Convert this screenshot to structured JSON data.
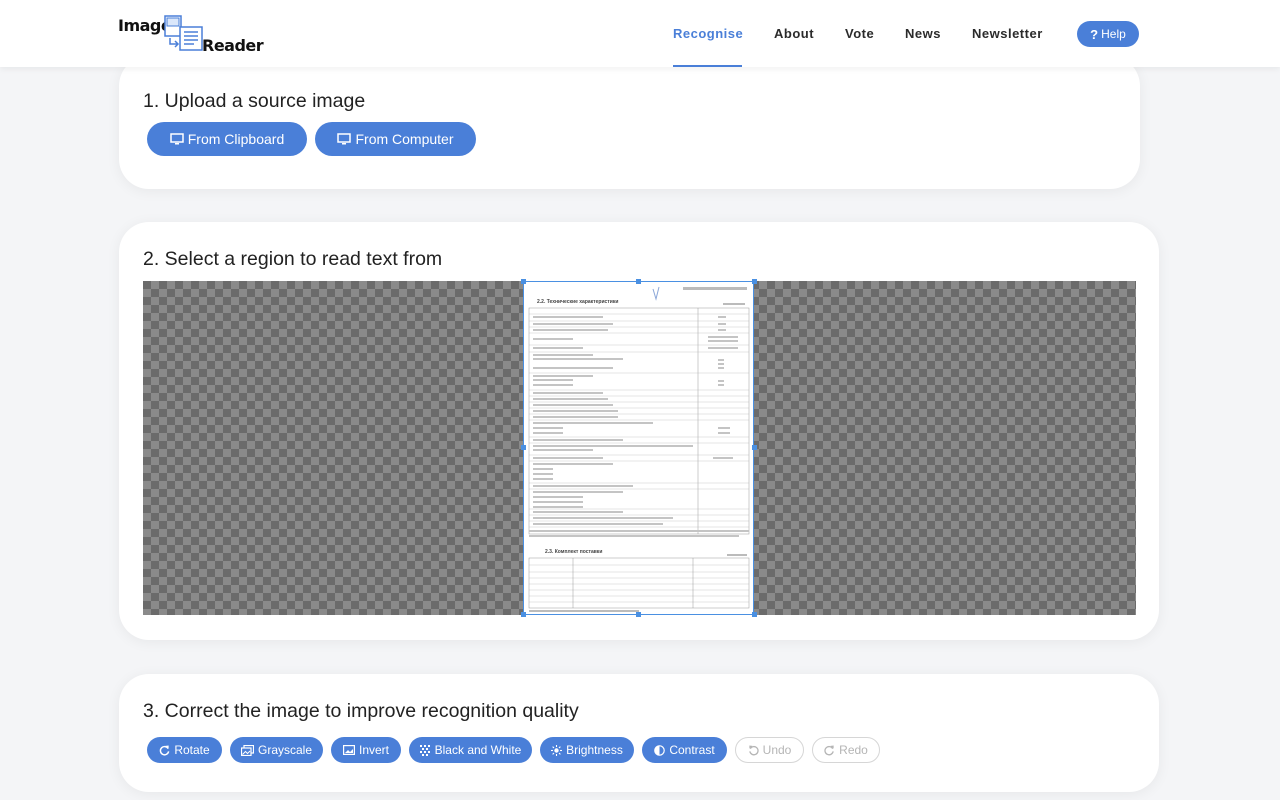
{
  "header": {
    "logo": {
      "word1": "Image",
      "word2": "Reader"
    },
    "nav": [
      {
        "label": "Recognise",
        "active": true
      },
      {
        "label": "About",
        "active": false
      },
      {
        "label": "Vote",
        "active": false
      },
      {
        "label": "News",
        "active": false
      },
      {
        "label": "Newsletter",
        "active": false
      }
    ],
    "help": {
      "label": "Help",
      "icon": "question-icon"
    }
  },
  "step1": {
    "title": "1. Upload a source image",
    "buttons": [
      {
        "label": "From Clipboard",
        "icon": "monitor-icon"
      },
      {
        "label": "From Computer",
        "icon": "monitor-icon"
      }
    ]
  },
  "step2": {
    "title": "2. Select a region to read text from",
    "document": {
      "section1": "2.2. Технические характеристики",
      "section2": "2.3. Комплект поставки"
    }
  },
  "step3": {
    "title": "3. Correct the image to improve recognition quality",
    "tools": [
      {
        "label": "Rotate",
        "icon": "rotate-icon",
        "enabled": true
      },
      {
        "label": "Grayscale",
        "icon": "images-icon",
        "enabled": true
      },
      {
        "label": "Invert",
        "icon": "image-icon",
        "enabled": true
      },
      {
        "label": "Black and White",
        "icon": "pattern-icon",
        "enabled": true
      },
      {
        "label": "Brightness",
        "icon": "sun-icon",
        "enabled": true
      },
      {
        "label": "Contrast",
        "icon": "contrast-icon",
        "enabled": true
      },
      {
        "label": "Undo",
        "icon": "undo-icon",
        "enabled": false
      },
      {
        "label": "Redo",
        "icon": "redo-icon",
        "enabled": false
      }
    ]
  },
  "colors": {
    "accent": "#4a7fd8",
    "selection": "#4a90e2",
    "disabled": "#b5b5b5"
  }
}
